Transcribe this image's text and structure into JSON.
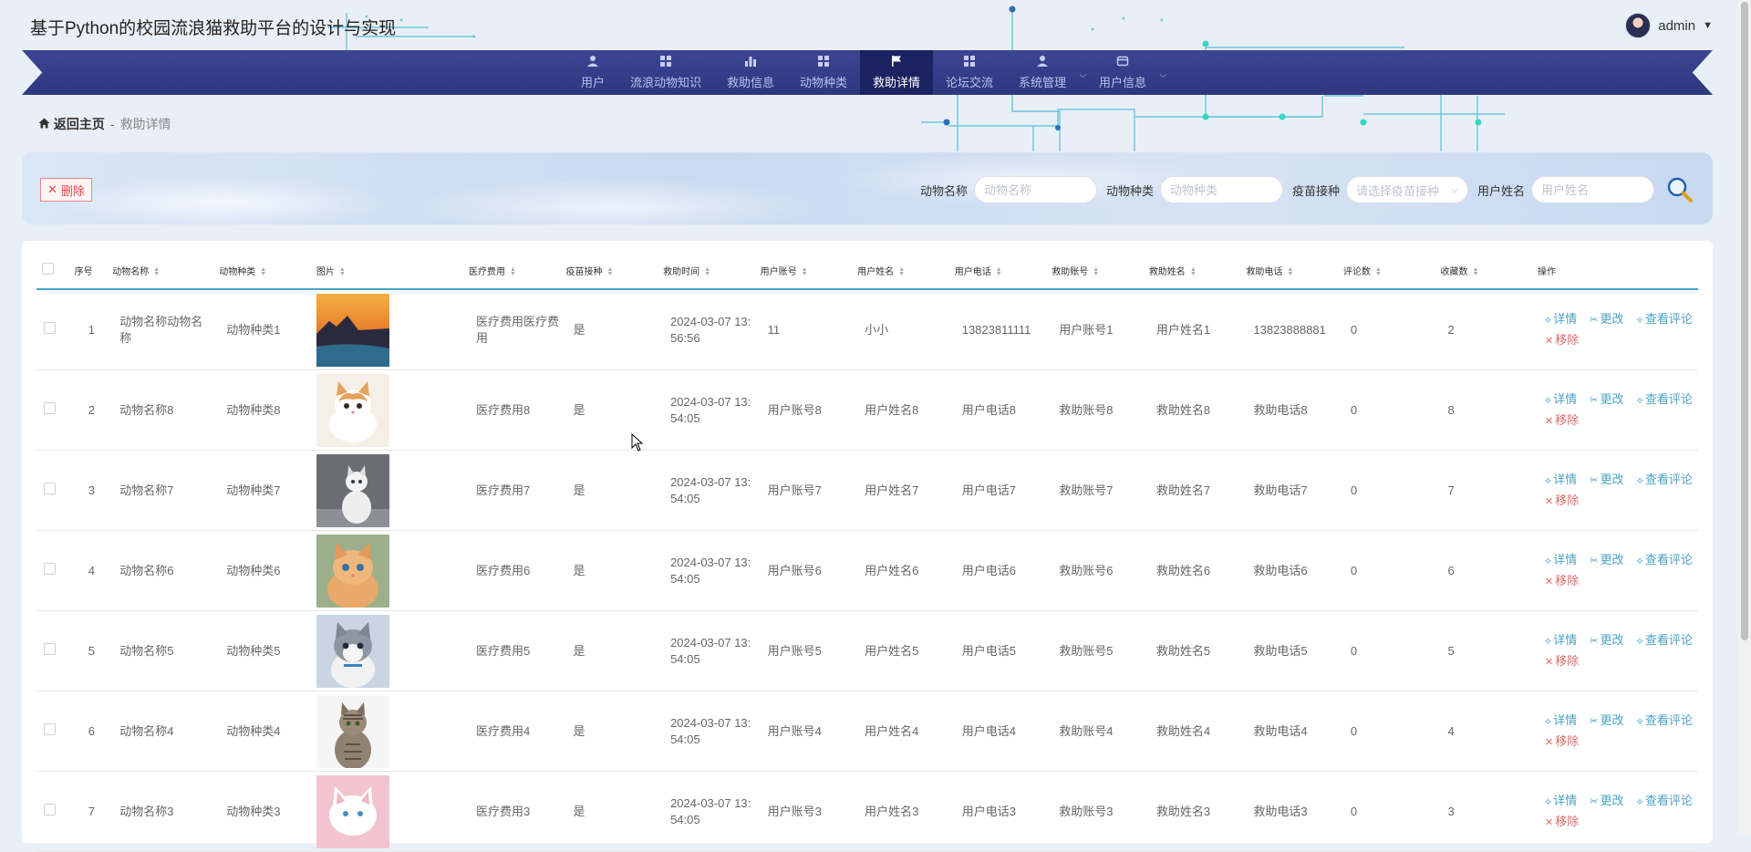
{
  "app": {
    "title": "基于Python的校园流浪猫救助平台的设计与实现"
  },
  "user": {
    "name": "admin"
  },
  "nav": {
    "items": [
      {
        "label": "用户",
        "icon": "user-icon"
      },
      {
        "label": "流浪动物知识",
        "icon": "grid-icon"
      },
      {
        "label": "救助信息",
        "icon": "bar-chart-icon"
      },
      {
        "label": "动物种类",
        "icon": "grid-icon"
      },
      {
        "label": "救助详情",
        "icon": "flag-icon",
        "active": true
      },
      {
        "label": "论坛交流",
        "icon": "grid-icon"
      },
      {
        "label": "系统管理",
        "icon": "user-icon",
        "dropdown": true
      },
      {
        "label": "用户信息",
        "icon": "card-icon",
        "dropdown": true
      }
    ]
  },
  "breadcrumb": {
    "home": "返回主页",
    "sep": "-",
    "current": "救助详情"
  },
  "toolbar": {
    "delete_label": "删除"
  },
  "filters": {
    "animal_name": {
      "label": "动物名称",
      "placeholder": "动物名称"
    },
    "animal_type": {
      "label": "动物种类",
      "placeholder": "动物种类"
    },
    "vaccine": {
      "label": "疫苗接种",
      "placeholder": "请选择疫苗接种"
    },
    "user_name": {
      "label": "用户姓名",
      "placeholder": "用户姓名"
    }
  },
  "table": {
    "columns": [
      "序号",
      "动物名称",
      "动物种类",
      "图片",
      "医疗费用",
      "疫苗接种",
      "救助时间",
      "用户账号",
      "用户姓名",
      "用户电话",
      "救助账号",
      "救助姓名",
      "救助电话",
      "评论数",
      "收藏数",
      "操作"
    ],
    "actions": {
      "detail": "详情",
      "edit": "更改",
      "comments": "查看评论",
      "remove": "移除"
    },
    "rows": [
      {
        "idx": "1",
        "name": "动物名称动物名称",
        "type": "动物种类1",
        "fee": "医疗费用医疗费用",
        "vaccine": "是",
        "time": "2024-03-07 13:56:56",
        "uacct": "11",
        "uname": "小小",
        "uphone": "13823811111",
        "racct": "用户账号1",
        "rname": "用户姓名1",
        "rphone": "13823888881",
        "comments": "0",
        "favs": "2",
        "img": "coast-sunset"
      },
      {
        "idx": "2",
        "name": "动物名称8",
        "type": "动物种类8",
        "fee": "医疗费用8",
        "vaccine": "是",
        "time": "2024-03-07 13:54:05",
        "uacct": "用户账号8",
        "uname": "用户姓名8",
        "uphone": "用户电话8",
        "racct": "救助账号8",
        "rname": "救助姓名8",
        "rphone": "救助电话8",
        "comments": "0",
        "favs": "8",
        "img": "kitten-orange-white"
      },
      {
        "idx": "3",
        "name": "动物名称7",
        "type": "动物种类7",
        "fee": "医疗费用7",
        "vaccine": "是",
        "time": "2024-03-07 13:54:05",
        "uacct": "用户账号7",
        "uname": "用户姓名7",
        "uphone": "用户电话7",
        "racct": "救助账号7",
        "rname": "救助姓名7",
        "rphone": "救助电话7",
        "comments": "0",
        "favs": "7",
        "img": "cat-white-gray"
      },
      {
        "idx": "4",
        "name": "动物名称6",
        "type": "动物种类6",
        "fee": "医疗费用6",
        "vaccine": "是",
        "time": "2024-03-07 13:54:05",
        "uacct": "用户账号6",
        "uname": "用户姓名6",
        "uphone": "用户电话6",
        "racct": "救助账号6",
        "rname": "救助姓名6",
        "rphone": "救助电话6",
        "comments": "0",
        "favs": "6",
        "img": "kitten-ginger"
      },
      {
        "idx": "5",
        "name": "动物名称5",
        "type": "动物种类5",
        "fee": "医疗费用5",
        "vaccine": "是",
        "time": "2024-03-07 13:54:05",
        "uacct": "用户账号5",
        "uname": "用户姓名5",
        "uphone": "用户电话5",
        "racct": "救助账号5",
        "rname": "救助姓名5",
        "rphone": "救助电话5",
        "comments": "0",
        "favs": "5",
        "img": "kitten-gray-white"
      },
      {
        "idx": "6",
        "name": "动物名称4",
        "type": "动物种类4",
        "fee": "医疗费用4",
        "vaccine": "是",
        "time": "2024-03-07 13:54:05",
        "uacct": "用户账号4",
        "uname": "用户姓名4",
        "uphone": "用户电话4",
        "racct": "救助账号4",
        "rname": "救助姓名4",
        "rphone": "救助电话4",
        "comments": "0",
        "favs": "4",
        "img": "cat-tabby"
      },
      {
        "idx": "7",
        "name": "动物名称3",
        "type": "动物种类3",
        "fee": "医疗费用3",
        "vaccine": "是",
        "time": "2024-03-07 13:54:05",
        "uacct": "用户账号3",
        "uname": "用户姓名3",
        "uphone": "用户电话3",
        "racct": "救助账号3",
        "rname": "救助姓名3",
        "rphone": "救助电话3",
        "comments": "0",
        "favs": "3",
        "img": "kitten-white"
      }
    ]
  },
  "colors": {
    "nav": "#343c88",
    "nav_active": "#1d2262",
    "accent": "#4aa3c5",
    "danger": "#e04848",
    "circuit": "#3fb6d8"
  }
}
